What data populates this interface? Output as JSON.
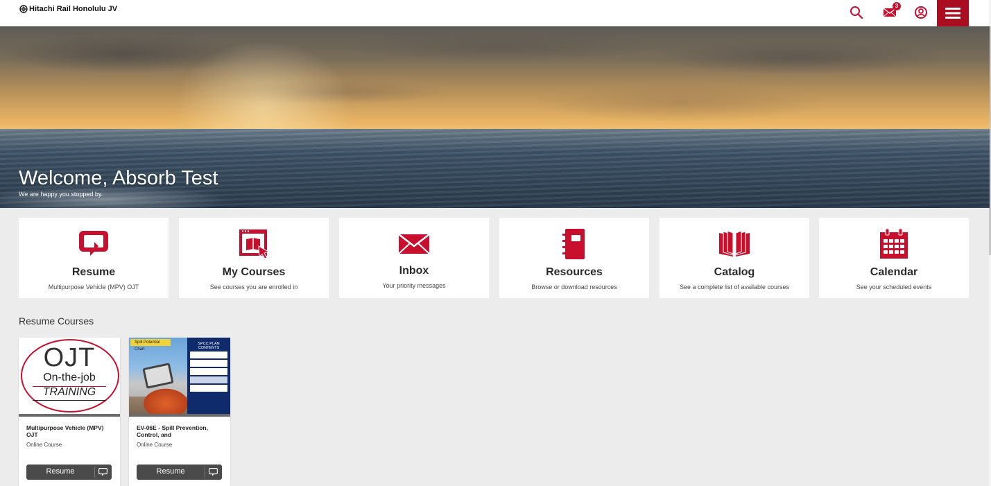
{
  "header": {
    "brand": "Hitachi Rail Honolulu JV",
    "icons": {
      "search": "search-icon",
      "messages": "mail-icon",
      "profile": "user-circle-icon",
      "menu": "hamburger-menu-icon"
    },
    "message_count": "3"
  },
  "hero": {
    "title": "Welcome, Absorb Test",
    "subtitle": "We are happy you stopped by."
  },
  "tiles": [
    {
      "title": "Resume",
      "description": "Multipurpose Vehicle (MPV) OJT",
      "icon": "resume-icon"
    },
    {
      "title": "My Courses",
      "description": "See courses you are enrolled in",
      "icon": "my-courses-icon"
    },
    {
      "title": "Inbox",
      "description": "Your priority messages",
      "icon": "envelope-icon"
    },
    {
      "title": "Resources",
      "description": "Browse or download resources",
      "icon": "notebook-icon"
    },
    {
      "title": "Catalog",
      "description": "See a complete list of available courses",
      "icon": "open-book-icon"
    },
    {
      "title": "Calendar",
      "description": "See your scheduled events",
      "icon": "calendar-icon"
    }
  ],
  "section": {
    "resume_title": "Resume Courses"
  },
  "courses": [
    {
      "title": "Multipurpose Vehicle (MPV) OJT",
      "type": "Online Course",
      "button": "Resume",
      "thumb": {
        "big": "OJT",
        "line1": "On-the-job",
        "line2": "TRAINING"
      }
    },
    {
      "title": "EV-06E - Spill Prevention, Control, and",
      "type": "Online Course",
      "button": "Resume",
      "thumb": {
        "chip": "Spill Potential Chart",
        "panel_title": "SPCC PLAN CONTENTS"
      }
    }
  ],
  "colors": {
    "accent": "#c8102e",
    "menu_bg": "#a90d1f",
    "page_bg": "#ececec",
    "button_bg": "#4a4a4a"
  }
}
